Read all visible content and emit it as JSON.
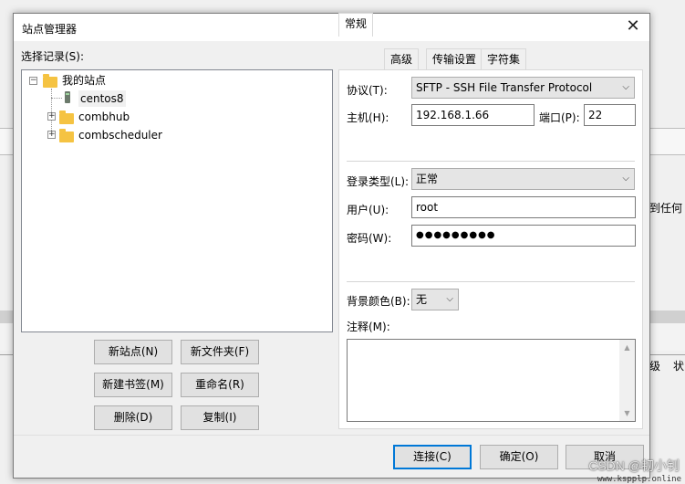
{
  "background": {
    "right_text_1": "到任何",
    "right_text_2": "状",
    "right_text_3": "级"
  },
  "dialog": {
    "title": "站点管理器",
    "close_glyph": "✕"
  },
  "tree": {
    "label": "选择记录(S):",
    "root": "我的站点",
    "items": [
      {
        "label": "centos8"
      },
      {
        "label": "combhub"
      },
      {
        "label": "combscheduler"
      }
    ]
  },
  "left_buttons": {
    "new_site": "新站点(N)",
    "new_folder": "新文件夹(F)",
    "new_bookmark": "新建书签(M)",
    "rename": "重命名(R)",
    "delete": "删除(D)",
    "copy": "复制(I)"
  },
  "tabs": [
    "常规",
    "高级",
    "传输设置",
    "字符集"
  ],
  "general": {
    "protocol_label": "协议(T):",
    "protocol_value": "SFTP - SSH File Transfer Protocol",
    "host_label": "主机(H):",
    "host_value": "192.168.1.66",
    "port_label": "端口(P):",
    "port_value": "22",
    "logon_type_label": "登录类型(L):",
    "logon_type_value": "正常",
    "user_label": "用户(U):",
    "user_value": "root",
    "password_label": "密码(W):",
    "password_value": "●●●●●●●●●",
    "bg_color_label": "背景颜色(B):",
    "bg_color_value": "无",
    "comments_label": "注释(M):"
  },
  "footer": {
    "connect": "连接(C)",
    "ok": "确定(O)",
    "cancel": "取消"
  },
  "watermark": {
    "text": "CSDN @韧小钊",
    "site": "www.kspplp.online"
  },
  "colors": {
    "accent": "#0078d7",
    "folder": "#f5c342"
  }
}
